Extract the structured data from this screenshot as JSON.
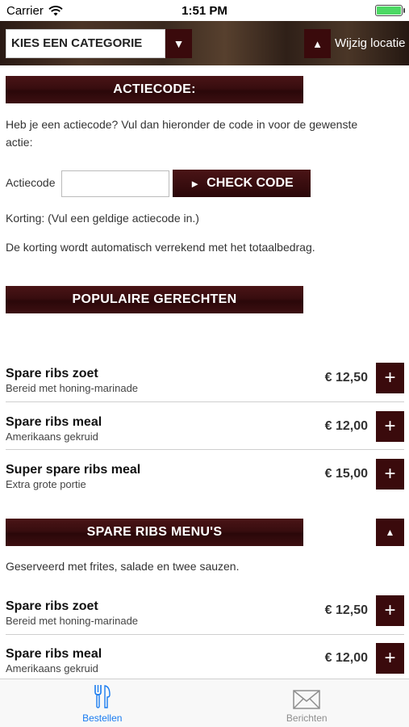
{
  "status_bar": {
    "carrier": "Carrier",
    "time": "1:51 PM"
  },
  "header": {
    "category_placeholder": "KIES EEN CATEGORIE",
    "dropdown_glyph": "▼",
    "location_glyph": "▲",
    "location_label": "Wijzig locatie"
  },
  "action_code": {
    "title": "ACTIECODE:",
    "intro": "Heb je een actiecode? Vul dan hieronder de code in voor de gewenste actie:",
    "field_label": "Actiecode",
    "field_value": "",
    "check_button": "CHECK CODE",
    "check_glyph": "►",
    "discount_text": "Korting: (Vul een geldige actiecode in.)",
    "note": "De korting wordt automatisch verrekend met het totaalbedrag."
  },
  "popular": {
    "title": "POPULAIRE GERECHTEN",
    "items": [
      {
        "name": "Spare ribs zoet",
        "desc": "Bereid met honing-marinade",
        "price": "€ 12,50"
      },
      {
        "name": "Spare ribs meal",
        "desc": "Amerikaans gekruid",
        "price": "€ 12,00"
      },
      {
        "name": "Super spare ribs meal",
        "desc": "Extra grote portie",
        "price": "€ 15,00"
      }
    ]
  },
  "menus": {
    "title": "SPARE RIBS MENU'S",
    "collapse_glyph": "▲",
    "description": "Geserveerd met frites, salade en twee sauzen.",
    "items": [
      {
        "name": "Spare ribs zoet",
        "desc": "Bereid met honing-marinade",
        "price": "€ 12,50"
      },
      {
        "name": "Spare ribs meal",
        "desc": "Amerikaans gekruid",
        "price": "€ 12,00"
      }
    ]
  },
  "add_glyph": "+",
  "tabs": [
    {
      "label": "Bestellen",
      "icon": "fork-knife-icon",
      "active": true
    },
    {
      "label": "Berichten",
      "icon": "envelope-icon",
      "active": false
    }
  ],
  "colors": {
    "brand": "#3a0a0c",
    "tab_active": "#1a7cf0",
    "battery": "#4cd964"
  }
}
